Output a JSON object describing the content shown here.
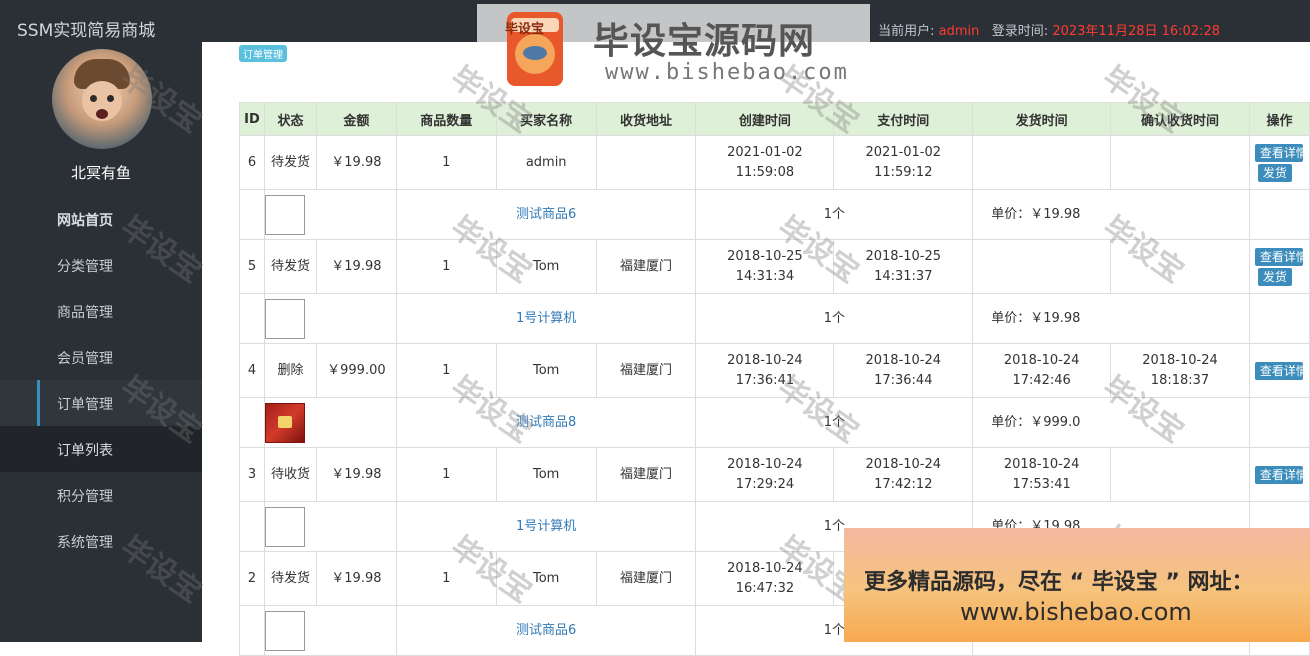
{
  "app": {
    "title": "SSM实现简易商城"
  },
  "header": {
    "current_user_label": "当前用户:",
    "current_user": "admin",
    "login_time_label": "登录时间:",
    "login_time": "2023年11月28日 16:02:28"
  },
  "sidebar": {
    "username": "北冥有鱼",
    "items": [
      {
        "label": "网站首页"
      },
      {
        "label": "分类管理"
      },
      {
        "label": "商品管理"
      },
      {
        "label": "会员管理"
      },
      {
        "label": "订单管理"
      },
      {
        "label": "订单列表"
      },
      {
        "label": "积分管理"
      },
      {
        "label": "系统管理"
      }
    ]
  },
  "page": {
    "badge": "订单管理"
  },
  "table": {
    "headers": [
      "ID",
      "状态",
      "金额",
      "商品数量",
      "买家名称",
      "收货地址",
      "创建时间",
      "支付时间",
      "发货时间",
      "确认收货时间",
      "操作"
    ],
    "view_button": "查看详情",
    "ship_button": "发货",
    "orders": [
      {
        "id": "6",
        "status": "待发货",
        "amount": "￥19.98",
        "qty": "1",
        "buyer": "admin",
        "address": "",
        "created": "2021-01-02 11:59:08",
        "paid": "2021-01-02 11:59:12",
        "shipped": "",
        "confirmed": "",
        "item": {
          "name": "测试商品6",
          "count": "1个",
          "price": "单价：￥19.98"
        }
      },
      {
        "id": "5",
        "status": "待发货",
        "amount": "￥19.98",
        "qty": "1",
        "buyer": "Tom",
        "address": "福建厦门",
        "created": "2018-10-25 14:31:34",
        "paid": "2018-10-25 14:31:37",
        "shipped": "",
        "confirmed": "",
        "item": {
          "name": "1号计算机",
          "count": "1个",
          "price": "单价：￥19.98"
        }
      },
      {
        "id": "4",
        "status": "删除",
        "amount": "￥999.00",
        "qty": "1",
        "buyer": "Tom",
        "address": "福建厦门",
        "created": "2018-10-24 17:36:41",
        "paid": "2018-10-24 17:36:44",
        "shipped": "2018-10-24 17:42:46",
        "confirmed": "2018-10-24 18:18:37",
        "item": {
          "name": "测试商品8",
          "count": "1个",
          "price": "单价：￥999.0"
        }
      },
      {
        "id": "3",
        "status": "待收货",
        "amount": "￥19.98",
        "qty": "1",
        "buyer": "Tom",
        "address": "福建厦门",
        "created": "2018-10-24 17:29:24",
        "paid": "2018-10-24 17:42:12",
        "shipped": "2018-10-24 17:53:41",
        "confirmed": "",
        "item": {
          "name": "1号计算机",
          "count": "1个",
          "price": "单价：￥19.98"
        }
      },
      {
        "id": "2",
        "status": "待发货",
        "amount": "￥19.98",
        "qty": "1",
        "buyer": "Tom",
        "address": "福建厦门",
        "created": "2018-10-24 16:47:32",
        "paid": "",
        "shipped": "",
        "confirmed": "",
        "item": {
          "name": "测试商品6",
          "count": "1个",
          "price": ""
        }
      }
    ]
  },
  "watermark": {
    "logo_title": "毕设宝源码网",
    "logo_badge": "毕设宝",
    "logo_url": "www.bishebao.com",
    "text": "毕设宝",
    "promo_line1": "更多精品源码，尽在 “ 毕设宝 ” 网址：",
    "promo_line2": "www.bishebao.com"
  }
}
